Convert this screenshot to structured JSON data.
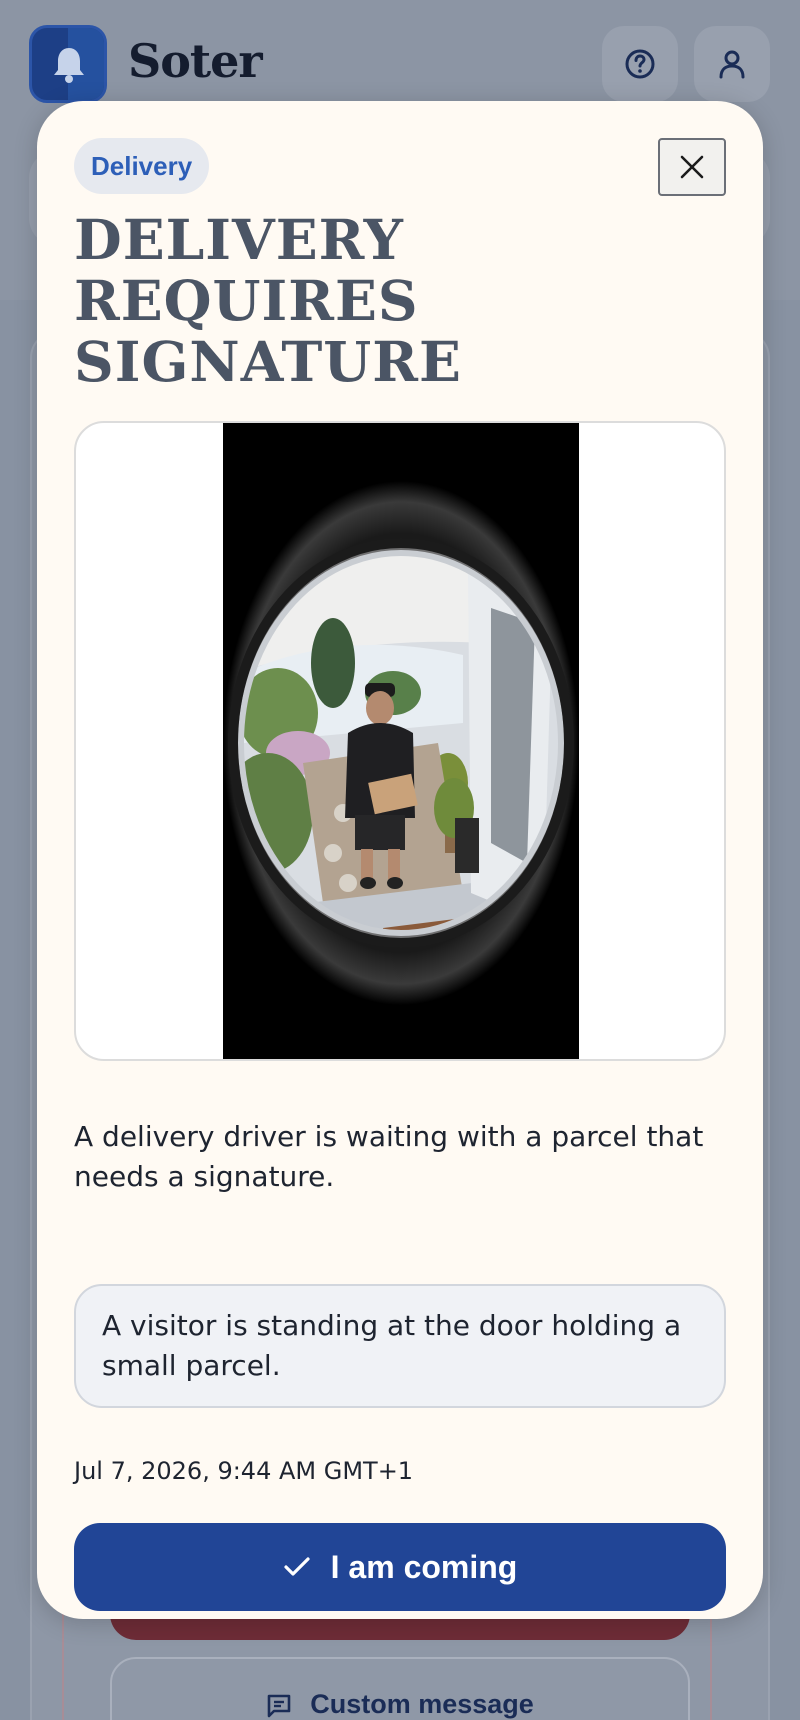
{
  "app": {
    "brand": "Soter",
    "header": {
      "help_icon": "help-circle-icon",
      "user_icon": "user-icon",
      "logo_icon": "bell-icon"
    }
  },
  "background": {
    "custom_message_label": "Custom message",
    "custom_message_icon": "message-icon"
  },
  "modal": {
    "badge": "Delivery",
    "title": "DELIVERY REQUIRES SIGNATURE",
    "close_icon": "close-icon",
    "image_alt": "Doorbell camera view: delivery driver holding a parcel at the front door",
    "description": "A delivery driver is waiting with a parcel that needs a signature.",
    "ai_summary": "A visitor is standing at the door holding a small parcel.",
    "timestamp": "Jul 7, 2026, 9:44 AM GMT+1",
    "primary_action": {
      "label": "I am coming",
      "icon": "check-icon"
    }
  },
  "colors": {
    "accent": "#214596",
    "badge_text": "#2d5fb8",
    "modal_bg": "#fffaf3",
    "title": "#4b5565"
  }
}
